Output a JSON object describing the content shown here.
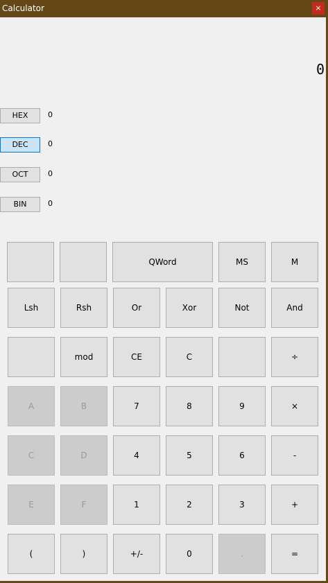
{
  "window": {
    "title": "Calculator",
    "close_glyph": "×"
  },
  "display": {
    "value": "0"
  },
  "radix": [
    {
      "label": "HEX",
      "value": "0",
      "active": false
    },
    {
      "label": "DEC",
      "value": "0",
      "active": true
    },
    {
      "label": "OCT",
      "value": "0",
      "active": false
    },
    {
      "label": "BIN",
      "value": "0",
      "active": false
    }
  ],
  "keys": {
    "row0": {
      "blank1": "",
      "blank2": "",
      "qword": "QWord",
      "ms": "MS",
      "m": "M"
    },
    "row1": [
      "Lsh",
      "Rsh",
      "Or",
      "Xor",
      "Not",
      "And"
    ],
    "row2": [
      "",
      "mod",
      "CE",
      "C",
      "",
      "÷"
    ],
    "row3": [
      "A",
      "B",
      "7",
      "8",
      "9",
      "×"
    ],
    "row4": [
      "C",
      "D",
      "4",
      "5",
      "6",
      "-"
    ],
    "row5": [
      "E",
      "F",
      "1",
      "2",
      "3",
      "+"
    ],
    "row6": [
      "(",
      ")",
      "+/-",
      "0",
      ".",
      "="
    ]
  },
  "colors": {
    "titlebar": "#654718",
    "active_radix": "#cce4f7",
    "close": "#c42b1c"
  }
}
